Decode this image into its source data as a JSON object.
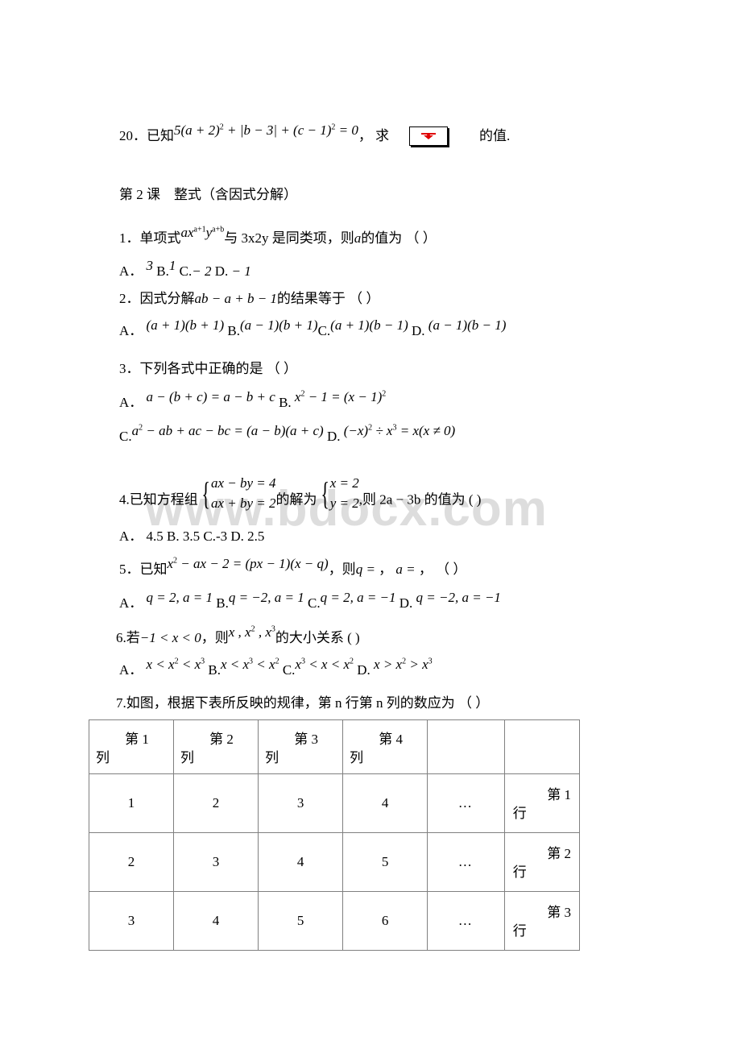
{
  "document": {
    "watermark": "www.bdocx.com"
  },
  "q20": {
    "number": "20．",
    "lead": "已知",
    "formula_prefix": "5(a + 2)",
    "formula_exp1": "2",
    "formula_mid": " + |b − 3| + (c − 1)",
    "formula_exp2": "2",
    "formula_suffix": " = 0",
    "comma": "，",
    "ask": "求",
    "image_alt": "broken-image",
    "tail": "的值."
  },
  "lesson": {
    "title": "第 2 课　整式（含因式分解）"
  },
  "q1": {
    "number": "1．",
    "text_a": "单项式",
    "mono_a": "ax",
    "mono_a_exp": "a+1",
    "mono_b": "y",
    "mono_b_exp": "a+b",
    "text_b": "与 3x2y 是同类项，则",
    "var": "a",
    "text_c": "的值为 （ ）",
    "options": [
      {
        "letter": "A．",
        "value": "3"
      },
      {
        "letter": "B.",
        "value": "1"
      },
      {
        "letter": "C.",
        "value": "− 2"
      },
      {
        "letter": "D.",
        "value": "− 1"
      }
    ]
  },
  "q2": {
    "number": "2．",
    "text_a": "因式分解",
    "expr": "ab − a + b − 1",
    "text_b": "的结果等于 （ ）",
    "options": [
      {
        "letter": "A．",
        "value": "(a + 1)(b + 1)"
      },
      {
        "letter": "B.",
        "value": "(a − 1)(b + 1)"
      },
      {
        "letter": "C.",
        "value": "(a + 1)(b − 1)"
      },
      {
        "letter": "D.",
        "value": "(a − 1)(b − 1)"
      }
    ]
  },
  "q3": {
    "number": "3．",
    "text": "下列各式中正确的是 （ ）",
    "optA_letter": "A．",
    "optA": "a − (b + c) = a − b + c",
    "optB_letter": "B.",
    "optB_pre": "x",
    "optB_exp": "2",
    "optB_mid": " − 1 = (x − 1)",
    "optB_exp2": "2",
    "optC_letter": "C.",
    "optC_pre": "a",
    "optC_exp": "2",
    "optC_rest": " − ab + ac − bc = (a − b)(a + c)",
    "optD_letter": "D.",
    "optD_pre": "(−x)",
    "optD_exp": "2",
    "optD_mid": " ÷ x",
    "optD_exp2": "3",
    "optD_rest": " = x(x ≠ 0)"
  },
  "q4": {
    "number": "4.",
    "text_a": "已知方程组",
    "sys1_line1": "ax − by = 4",
    "sys1_line2": "ax + by = 2",
    "text_b": "的解为",
    "sys2_line1": "x = 2",
    "sys2_line2": "y = 2",
    "text_c": ",则 2a − 3b 的值为 ( )",
    "options": [
      {
        "letter": "A．",
        "value": "4.5"
      },
      {
        "letter": "B.",
        "value": "3.5"
      },
      {
        "letter": "C.",
        "value": "-3"
      },
      {
        "letter": "D.",
        "value": "2.5"
      }
    ]
  },
  "q5": {
    "number": "5．",
    "text_a": "已知",
    "expr_pre": "x",
    "expr_exp": "2",
    "expr_rest": " − ax − 2 = (px − 1)(x − q)",
    "text_b": "，则",
    "q_eq": "q = ",
    "comma1": "，",
    "a_eq": "a = ",
    "comma2": "，",
    "paren": "（ ）",
    "options": [
      {
        "letter": "A．",
        "value": "q = 2, a = 1"
      },
      {
        "letter": "B.",
        "value": "q = −2, a = 1"
      },
      {
        "letter": "C.",
        "value": "q = 2, a = −1"
      },
      {
        "letter": "D.",
        "value": "q = −2, a = −1"
      }
    ]
  },
  "q6": {
    "number": "6.",
    "text_a": "若",
    "cond": "−1 < x < 0",
    "text_b": "，则",
    "vars_pre": "x , x",
    "vars_exp1": "2",
    "vars_mid": " , x",
    "vars_exp2": "3",
    "text_c": "的大小关系 ( )",
    "options": [
      {
        "letter": "A．",
        "parts": [
          "x < x",
          "2",
          " < x",
          "3"
        ]
      },
      {
        "letter": "B.",
        "parts": [
          "x < x",
          "3",
          " < x",
          "2"
        ]
      },
      {
        "letter": "C.",
        "parts": [
          "x",
          "3",
          " < x < x",
          "2"
        ]
      },
      {
        "letter": "D.",
        "parts": [
          "x > x",
          "2",
          " > x",
          "3"
        ]
      }
    ]
  },
  "q7": {
    "number": "7.",
    "text": "如图，根据下表所反映的规律，第 n 行第 n 列的数应为 （ ）"
  },
  "table": {
    "headers": [
      {
        "top": "第 1",
        "bot": "列"
      },
      {
        "top": "第 2",
        "bot": "列"
      },
      {
        "top": "第 3",
        "bot": "列"
      },
      {
        "top": "第 4",
        "bot": "列"
      },
      {
        "top": "",
        "bot": ""
      },
      {
        "top": "",
        "bot": ""
      }
    ],
    "rows": [
      {
        "cells": [
          "1",
          "2",
          "3",
          "4",
          "…"
        ],
        "label_top": "第 1",
        "label_bot": "行"
      },
      {
        "cells": [
          "2",
          "3",
          "4",
          "5",
          "…"
        ],
        "label_top": "第 2",
        "label_bot": "行"
      },
      {
        "cells": [
          "3",
          "4",
          "5",
          "6",
          "…"
        ],
        "label_top": "第 3",
        "label_bot": "行"
      }
    ]
  }
}
